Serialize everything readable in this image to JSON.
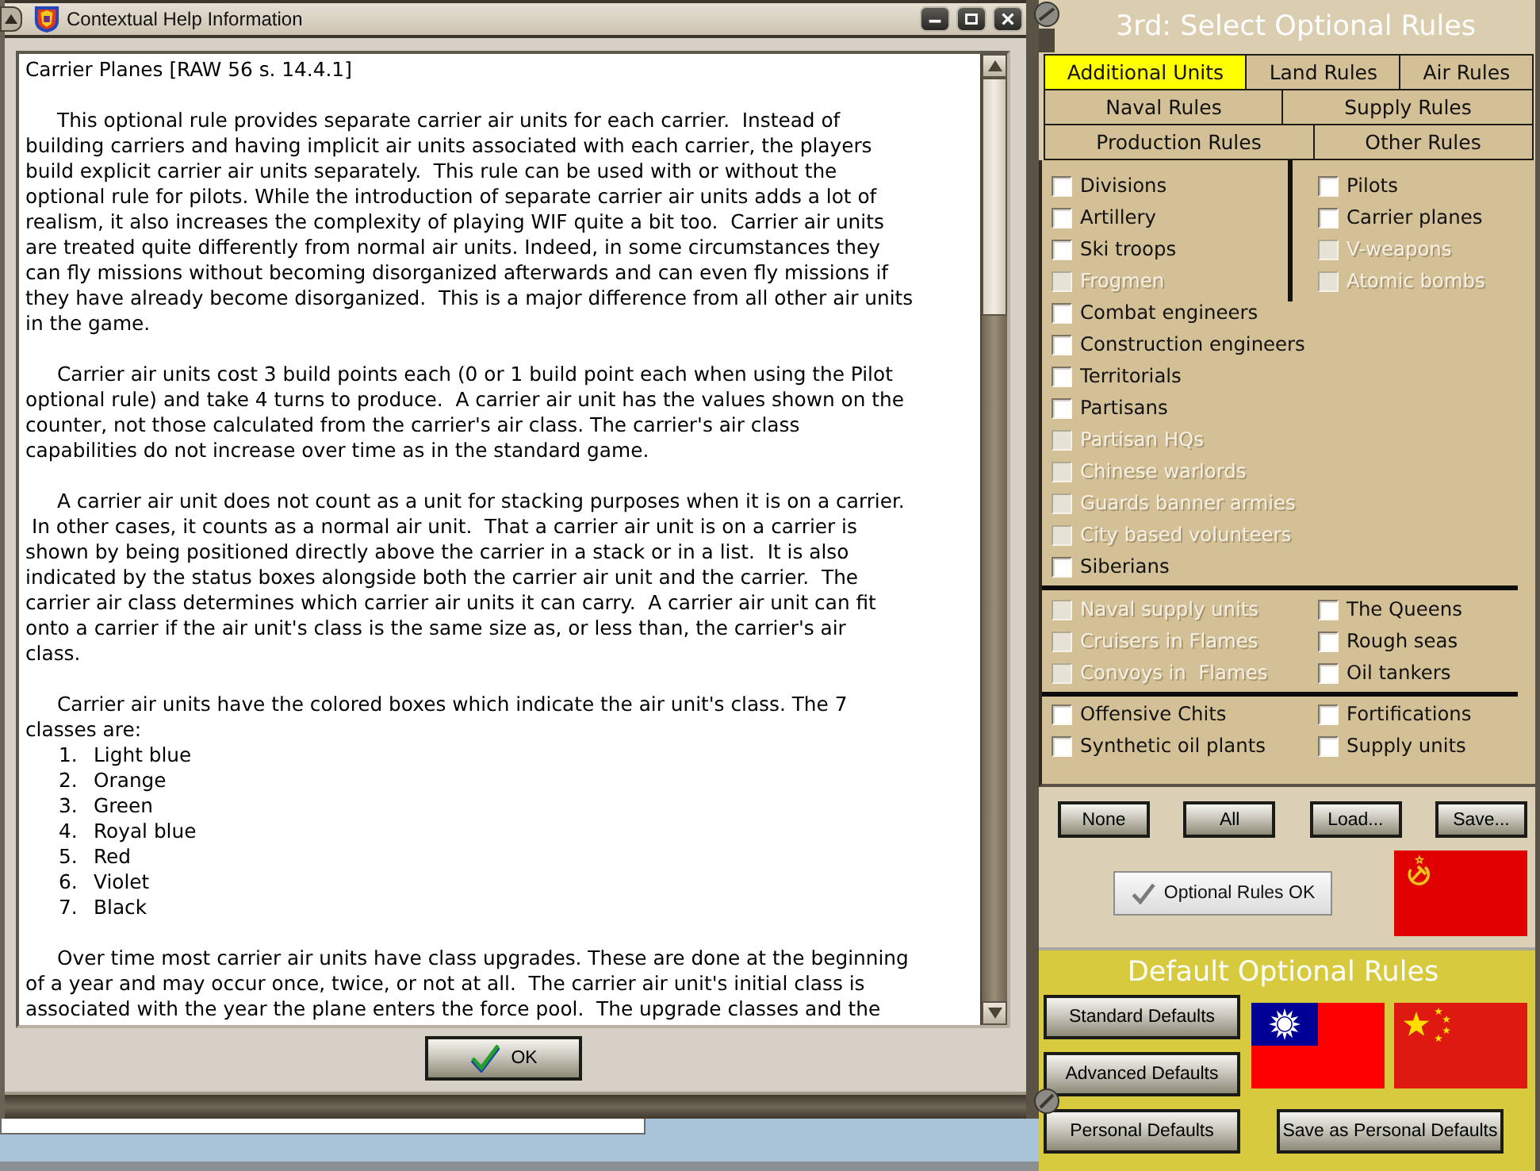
{
  "help_window": {
    "title": "Contextual Help Information",
    "blocks": [
      {
        "kind": "heading",
        "text": "Carrier Planes [RAW 56 s. 14.4.1]"
      },
      {
        "kind": "paragraph",
        "text": "This optional rule provides separate carrier air units for each carrier.  Instead of\nbuilding carriers and having implicit air units associated with each carrier, the players\nbuild explicit carrier air units separately.  This rule can be used with or without the\noptional rule for pilots. While the introduction of separate carrier air units adds a lot of\nrealism, it also increases the complexity of playing WIF quite a bit too.  Carrier air units\nare treated quite differently from normal air units. Indeed, in some circumstances they\ncan fly missions without becoming disorganized afterwards and can even fly missions if\nthey have already become disorganized.  This is a major difference from all other air units\nin the game."
      },
      {
        "kind": "paragraph",
        "text": "Carrier air units cost 3 build points each (0 or 1 build point each when using the Pilot\noptional rule) and take 4 turns to produce.  A carrier air unit has the values shown on the\ncounter, not those calculated from the carrier's air class. The carrier's air class\ncapabilities do not increase over time as in the standard game."
      },
      {
        "kind": "paragraph",
        "text": "A carrier air unit does not count as a unit for stacking purposes when it is on a carrier.\n In other cases, it counts as a normal air unit.  That a carrier air unit is on a carrier is\nshown by being positioned directly above the carrier in a stack or in a list.  It is also\nindicated by the status boxes alongside both the carrier air unit and the carrier.  The\ncarrier air class determines which carrier air units it can carry.  A carrier air unit can fit\nonto a carrier if the air unit's class is the same size as, or less than, the carrier's air\nclass."
      },
      {
        "kind": "paragraph",
        "text": "Carrier air units have the colored boxes which indicate the air unit's class. The 7\nclasses are:"
      },
      {
        "kind": "numbered_list",
        "items": [
          {
            "number": "1.",
            "label": "Light blue"
          },
          {
            "number": "2.",
            "label": "Orange"
          },
          {
            "number": "3.",
            "label": "Green"
          },
          {
            "number": "4.",
            "label": "Royal blue"
          },
          {
            "number": "5.",
            "label": "Red"
          },
          {
            "number": "6.",
            "label": "Violet"
          },
          {
            "number": "7.",
            "label": "Black"
          }
        ]
      },
      {
        "kind": "paragraph",
        "text": "Over time most carrier air units have class upgrades. These are done at the beginning\nof a year and may occur once, twice, or not at all.  The carrier air unit's initial class is\nassociated with the year the plane enters the force pool.  The upgrade classes and the"
      }
    ],
    "ok_button": "OK"
  },
  "optional_rules": {
    "title": "3rd: Select Optional Rules",
    "tab_rows": [
      [
        {
          "label": "Additional Units",
          "selected": true
        },
        {
          "label": "Land Rules",
          "selected": false
        },
        {
          "label": "Air Rules",
          "selected": false
        }
      ],
      [
        {
          "label": "Naval Rules",
          "selected": false
        },
        {
          "label": "Supply Rules",
          "selected": false
        }
      ],
      [
        {
          "label": "Production Rules",
          "selected": false
        },
        {
          "label": "Other Rules",
          "selected": false
        }
      ]
    ],
    "sections": [
      {
        "left": [
          {
            "label": "Divisions",
            "checked": false,
            "disabled": false
          },
          {
            "label": "Artillery",
            "checked": false,
            "disabled": false
          },
          {
            "label": "Ski troops",
            "checked": false,
            "disabled": false
          },
          {
            "label": "Frogmen",
            "checked": false,
            "disabled": true
          },
          {
            "label": "Combat engineers",
            "checked": false,
            "disabled": false
          },
          {
            "label": "Construction engineers",
            "checked": false,
            "disabled": false
          },
          {
            "label": "Territorials",
            "checked": false,
            "disabled": false
          },
          {
            "label": "Partisans",
            "checked": false,
            "disabled": false
          },
          {
            "label": "Partisan HQs",
            "checked": false,
            "disabled": true
          },
          {
            "label": "Chinese warlords",
            "checked": false,
            "disabled": true
          },
          {
            "label": "Guards banner armies",
            "checked": false,
            "disabled": true
          },
          {
            "label": "City based volunteers",
            "checked": false,
            "disabled": true
          },
          {
            "label": "Siberians",
            "checked": false,
            "disabled": false
          }
        ],
        "right": [
          {
            "label": "Pilots",
            "checked": false,
            "disabled": false
          },
          {
            "label": "Carrier planes",
            "checked": false,
            "disabled": false
          },
          {
            "label": "V-weapons",
            "checked": false,
            "disabled": true
          },
          {
            "label": "Atomic bombs",
            "checked": false,
            "disabled": true
          }
        ]
      },
      {
        "left": [
          {
            "label": "Naval supply units",
            "checked": false,
            "disabled": true
          },
          {
            "label": "Cruisers in Flames",
            "checked": false,
            "disabled": true
          },
          {
            "label": "Convoys in  Flames",
            "checked": false,
            "disabled": true
          }
        ],
        "right": [
          {
            "label": "The Queens",
            "checked": false,
            "disabled": false
          },
          {
            "label": "Rough seas",
            "checked": false,
            "disabled": false
          },
          {
            "label": "Oil tankers",
            "checked": false,
            "disabled": false
          }
        ]
      },
      {
        "left": [
          {
            "label": "Offensive Chits",
            "checked": false,
            "disabled": false
          },
          {
            "label": "Synthetic oil plants",
            "checked": false,
            "disabled": false
          }
        ],
        "right": [
          {
            "label": "Fortifications",
            "checked": false,
            "disabled": false
          },
          {
            "label": "Supply units",
            "checked": false,
            "disabled": false
          }
        ]
      }
    ],
    "buttons": [
      "None",
      "All",
      "Load...",
      "Save..."
    ],
    "ok_button": "Optional Rules OK"
  },
  "default_rules": {
    "title": "Default Optional Rules",
    "buttons": [
      "Standard Defaults",
      "Advanced Defaults",
      "Personal Defaults"
    ],
    "save_button": "Save as Personal Defaults"
  }
}
